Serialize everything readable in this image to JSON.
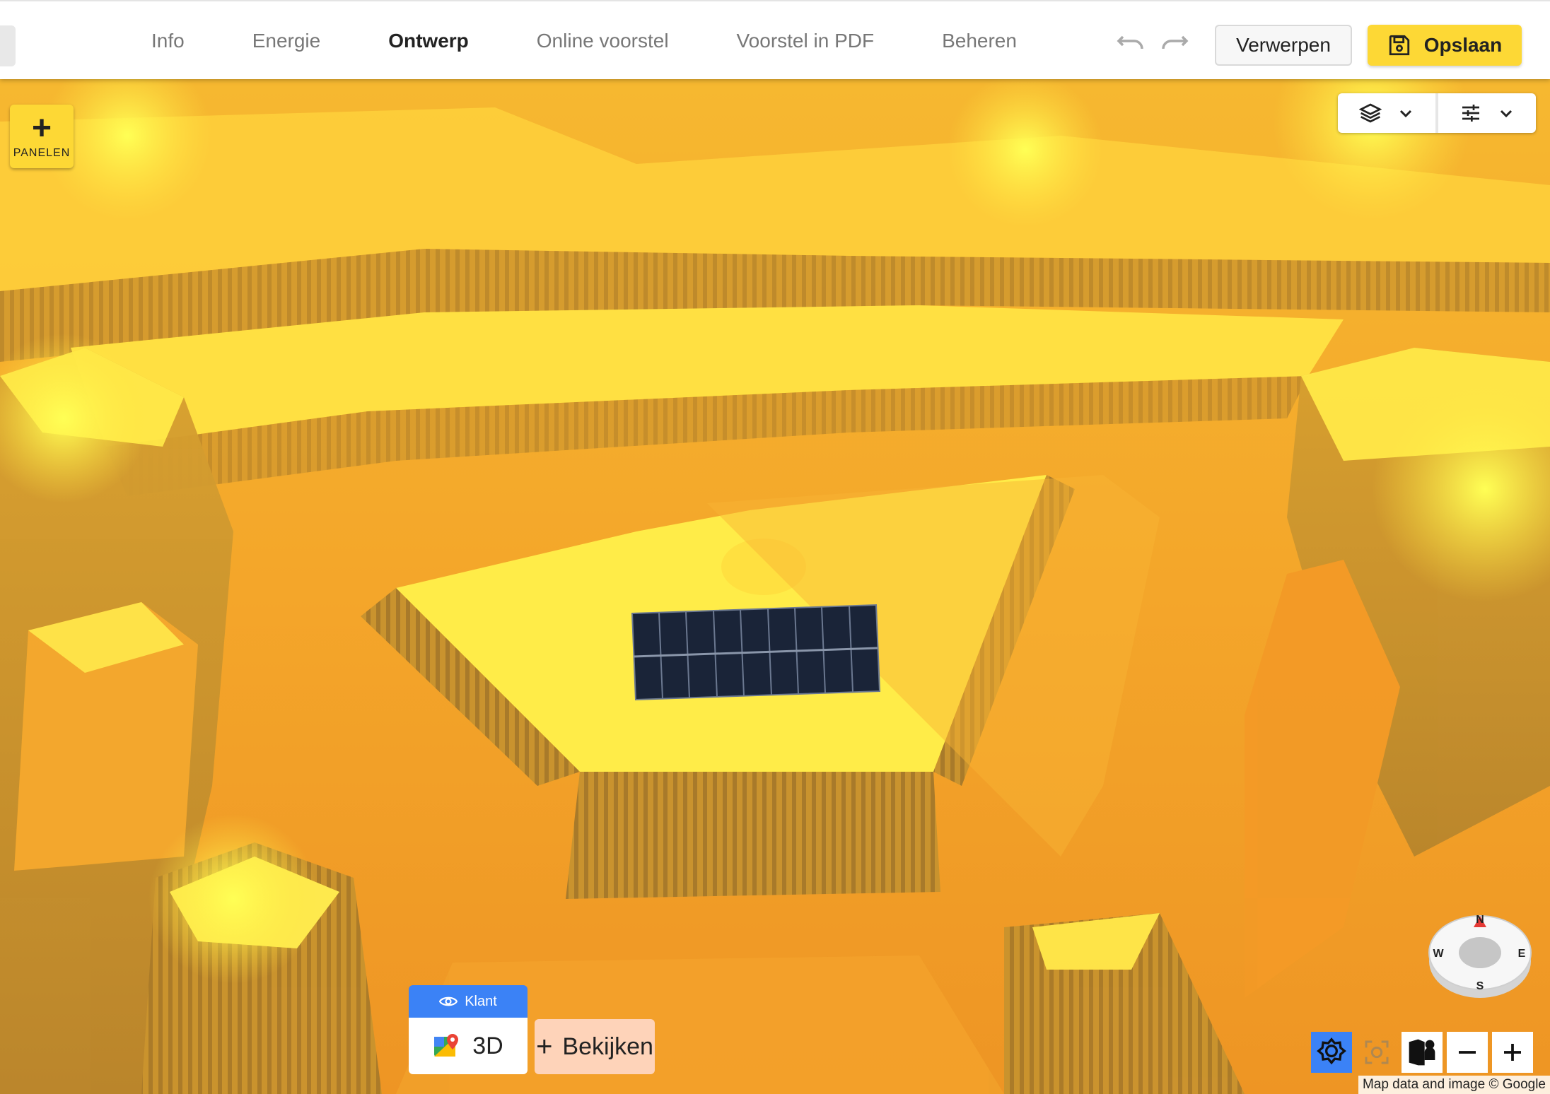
{
  "nav": {
    "tabs": [
      {
        "label": "Info",
        "active": false
      },
      {
        "label": "Energie",
        "active": false
      },
      {
        "label": "Ontwerp",
        "active": true
      },
      {
        "label": "Online voorstel",
        "active": false
      },
      {
        "label": "Voorstel in PDF",
        "active": false
      },
      {
        "label": "Beheren",
        "active": false
      }
    ],
    "undo_icon": "undo-icon",
    "redo_icon": "redo-icon",
    "discard_label": "Verwerpen",
    "save_label": "Opslaan",
    "save_icon": "floppy-disk-icon"
  },
  "map": {
    "add_panels_label": "PANELEN",
    "layers_icon": "layers-icon",
    "settings_icon": "sliders-icon",
    "view_tag_label": "Klant",
    "view_mode_label": "3D",
    "view_mode_icon": "google-maps-icon",
    "view_button_label": "Bekijken",
    "compass": {
      "n": "N",
      "e": "E",
      "s": "S",
      "w": "W"
    },
    "attribution": "Map data and image © Google",
    "colors": {
      "accent": "#fdd835",
      "tag_blue": "#3b82f6",
      "flux_light": "#ffee44",
      "flux_dark": "#e07a1c",
      "panel": "#1a2438"
    }
  }
}
